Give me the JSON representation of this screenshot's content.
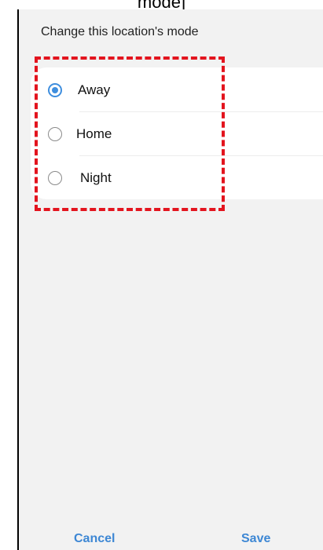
{
  "caption": "mode]",
  "dialog": {
    "title": "Change this location's mode",
    "options": [
      {
        "label": "Away",
        "selected": true
      },
      {
        "label": "Home",
        "selected": false
      },
      {
        "label": "Night",
        "selected": false
      }
    ],
    "cancel_label": "Cancel",
    "save_label": "Save"
  },
  "colors": {
    "accent": "#3e8ede",
    "highlight": "#e3141e",
    "background": "#f2f2f2"
  }
}
